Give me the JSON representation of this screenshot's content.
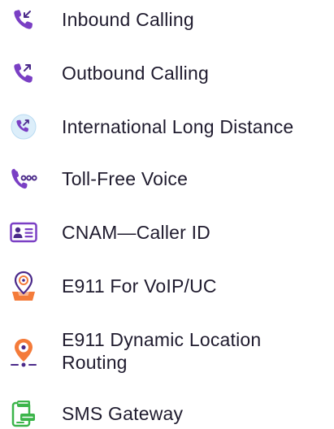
{
  "colors": {
    "purple": "#7a3fc4",
    "purple_dark": "#4b2a8a",
    "orange": "#f47b3a",
    "green": "#3bb54a",
    "light_blue": "#dceefa",
    "text": "#1f1b2e"
  },
  "services": {
    "items": [
      {
        "label": "Inbound Calling",
        "icon": "inbound-call-icon"
      },
      {
        "label": "Outbound Calling",
        "icon": "outbound-call-icon"
      },
      {
        "label": "International Long Distance",
        "icon": "international-call-icon"
      },
      {
        "label": "Toll-Free Voice",
        "icon": "toll-free-icon"
      },
      {
        "label": "CNAM—Caller ID",
        "icon": "caller-id-icon"
      },
      {
        "label": "E911 For VoIP/UC",
        "icon": "e911-location-icon"
      },
      {
        "label": "E911 Dynamic Location Routing",
        "icon": "e911-dynamic-routing-icon"
      },
      {
        "label": "SMS Gateway",
        "icon": "sms-gateway-icon"
      }
    ]
  }
}
